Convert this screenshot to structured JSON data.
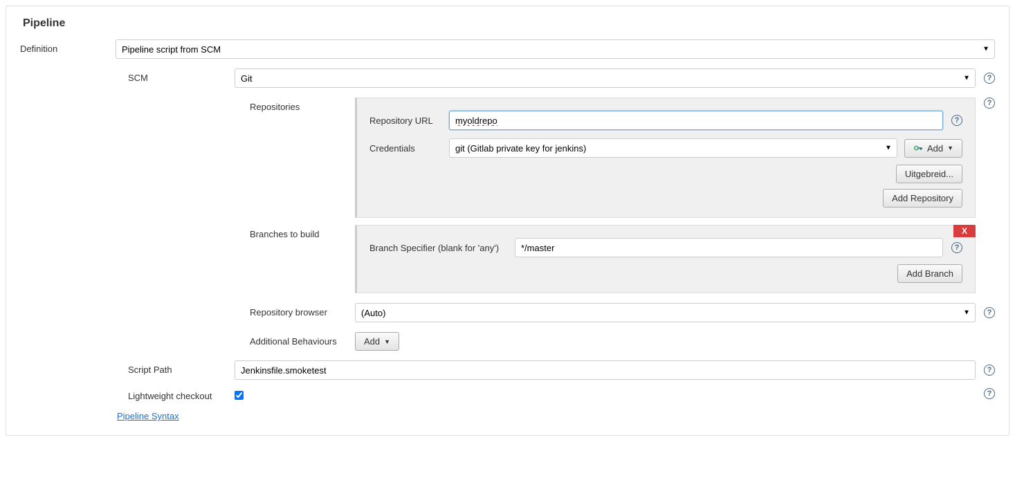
{
  "section_title": "Pipeline",
  "definition": {
    "label": "Definition",
    "value": "Pipeline script from SCM"
  },
  "scm": {
    "label": "SCM",
    "value": "Git"
  },
  "repositories": {
    "label": "Repositories",
    "url_label": "Repository URL",
    "url_value": "myoldrepo",
    "credentials_label": "Credentials",
    "credentials_value": "git (Gitlab private key for jenkins)",
    "add_cred_label": "Add",
    "advanced_label": "Uitgebreid...",
    "add_repo_label": "Add Repository"
  },
  "branches": {
    "label": "Branches to build",
    "specifier_label": "Branch Specifier (blank for 'any')",
    "specifier_value": "*/master",
    "add_branch_label": "Add Branch",
    "delete_label": "X"
  },
  "repo_browser": {
    "label": "Repository browser",
    "value": "(Auto)"
  },
  "additional_behaviours": {
    "label": "Additional Behaviours",
    "add_label": "Add"
  },
  "script_path": {
    "label": "Script Path",
    "value": "Jenkinsfile.smoketest"
  },
  "lightweight": {
    "label": "Lightweight checkout",
    "checked": true
  },
  "pipeline_syntax_link": "Pipeline Syntax",
  "help_glyph": "?"
}
